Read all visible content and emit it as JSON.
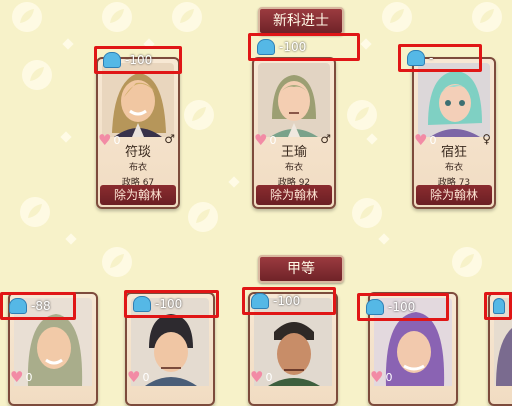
{
  "header": {
    "section1": "新科进士",
    "section2": "甲等"
  },
  "colors": {
    "card_border": "#7d4b3c",
    "button_bg": "#8b2c2f",
    "highlight_box": "#e01616",
    "heart": "#f28ba5"
  },
  "top_row": [
    {
      "name": "符琰",
      "title": "布衣",
      "policy_label": "政略 67",
      "action": "除为翰林",
      "affinity": "0",
      "gender": "♂",
      "attribute": "-100"
    },
    {
      "name": "王瑜",
      "title": "布衣",
      "policy_label": "政略 92",
      "action": "除为翰林",
      "affinity": "0",
      "gender": "♂",
      "attribute": "-100"
    },
    {
      "name": "宿狂",
      "title": "布衣",
      "policy_label": "政略 73",
      "action": "除为翰林",
      "affinity": "0",
      "gender": "♀",
      "attribute": "-"
    }
  ],
  "bottom_row": [
    {
      "affinity": "0",
      "attribute": "-88"
    },
    {
      "affinity": "0",
      "attribute": "-100"
    },
    {
      "affinity": "0",
      "attribute": "-100"
    },
    {
      "affinity": "0",
      "attribute": "-100"
    },
    {
      "affinity": "",
      "attribute": ""
    }
  ]
}
